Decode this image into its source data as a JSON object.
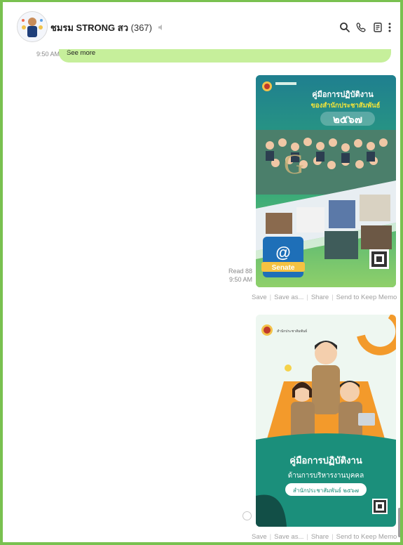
{
  "header": {
    "chat_name": "ชมรม STRONG สว",
    "member_count": "(367)",
    "mute_icon": "speaker-muted-icon",
    "icons": [
      "search-icon",
      "phone-icon",
      "notes-icon",
      "more-icon"
    ]
  },
  "previous_message": {
    "see_more_label": "See more",
    "time": "9:50 AM"
  },
  "messages": [
    {
      "read": "Read 88",
      "time": "9:50 AM",
      "image": {
        "title_line1": "คู่มือการปฏิบัติงาน",
        "title_line2": "ของสำนักประชาสัมพันธ์",
        "year": "๒๕๖๗",
        "badge_symbol": "@",
        "badge_text": "Senate"
      }
    },
    {
      "image": {
        "org_name": "สำนักประชาสัมพันธ์",
        "title_line1": "คู่มือการปฏิบัติงาน",
        "title_line2": "ด้านการบริหารงานบุคคล",
        "pill": "สำนักประชาสัมพันธ์ ๒๕๖๗"
      }
    }
  ],
  "actions": {
    "save": "Save",
    "save_as": "Save as...",
    "share": "Share",
    "keep": "Send to Keep Memo"
  },
  "colors": {
    "frame": "#79c150",
    "bubble": "#c6ef9b",
    "teal": "#1b8f7b"
  }
}
